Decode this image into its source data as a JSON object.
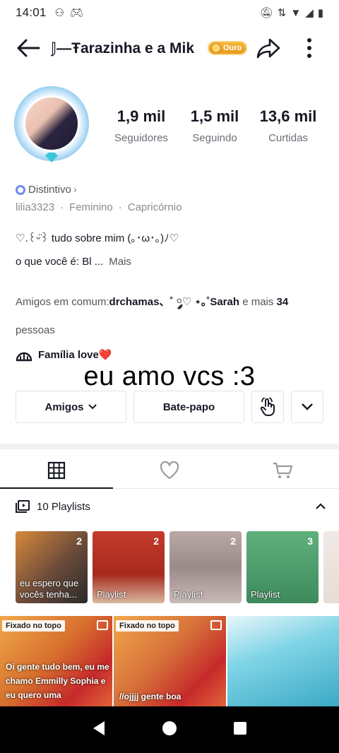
{
  "status_bar": {
    "time": "14:01"
  },
  "header": {
    "title": "𝕁—Ŧarazinha e a Mik",
    "badge": "Ouro"
  },
  "profile": {
    "stats": [
      {
        "value": "1,9 mil",
        "label": "Seguidores"
      },
      {
        "value": "1,5 mil",
        "label": "Seguindo"
      },
      {
        "value": "13,6 mil",
        "label": "Curtidas"
      }
    ],
    "distintivo": "Distintivo",
    "username": "lilia3323",
    "gender": "Feminino",
    "sign": "Capricórnio",
    "bio_line1": "♡.꒰ᵕ̈꒱ tudo sobre mim (｡･ω･｡)ﾉ♡",
    "bio_line2": "o que você é: Bl ...",
    "more": "Mais",
    "friends_prefix": "Amigos em comum:",
    "friends_names": "drchamas、˚ ༘♡ ⋆｡˚Sarah",
    "friends_and": " e mais ",
    "friends_count": "34",
    "friends_suffix": "pessoas",
    "family": "Família love❤️"
  },
  "overlay_text": "eu amo vcs :3",
  "buttons": {
    "friends": "Amigos",
    "chat": "Bate-papo"
  },
  "playlists": {
    "title": "10 Playlists",
    "items": [
      {
        "count": "2",
        "label": "eu espero que vocês tenha...",
        "color": "#6a4a3a"
      },
      {
        "count": "2",
        "label": "Playlist",
        "color": "#b83a2a"
      },
      {
        "count": "2",
        "label": "Playlist",
        "color": "#9a8a8a"
      },
      {
        "count": "3",
        "label": "Playlist",
        "color": "#4a9a6a"
      },
      {
        "count": "",
        "label": "",
        "color": "#f0eae6"
      }
    ]
  },
  "videos": [
    {
      "pinned": "Fixado no topo",
      "caption": "Oi gente tudo bem, eu me chamo Emmilly Sophia e eu quero uma",
      "color": "#e0863a"
    },
    {
      "pinned": "Fixado no topo",
      "caption": "//ojjjj gente boa",
      "color": "#d6703a"
    },
    {
      "pinned": "",
      "caption": "",
      "color": "#7fd4e6"
    }
  ]
}
